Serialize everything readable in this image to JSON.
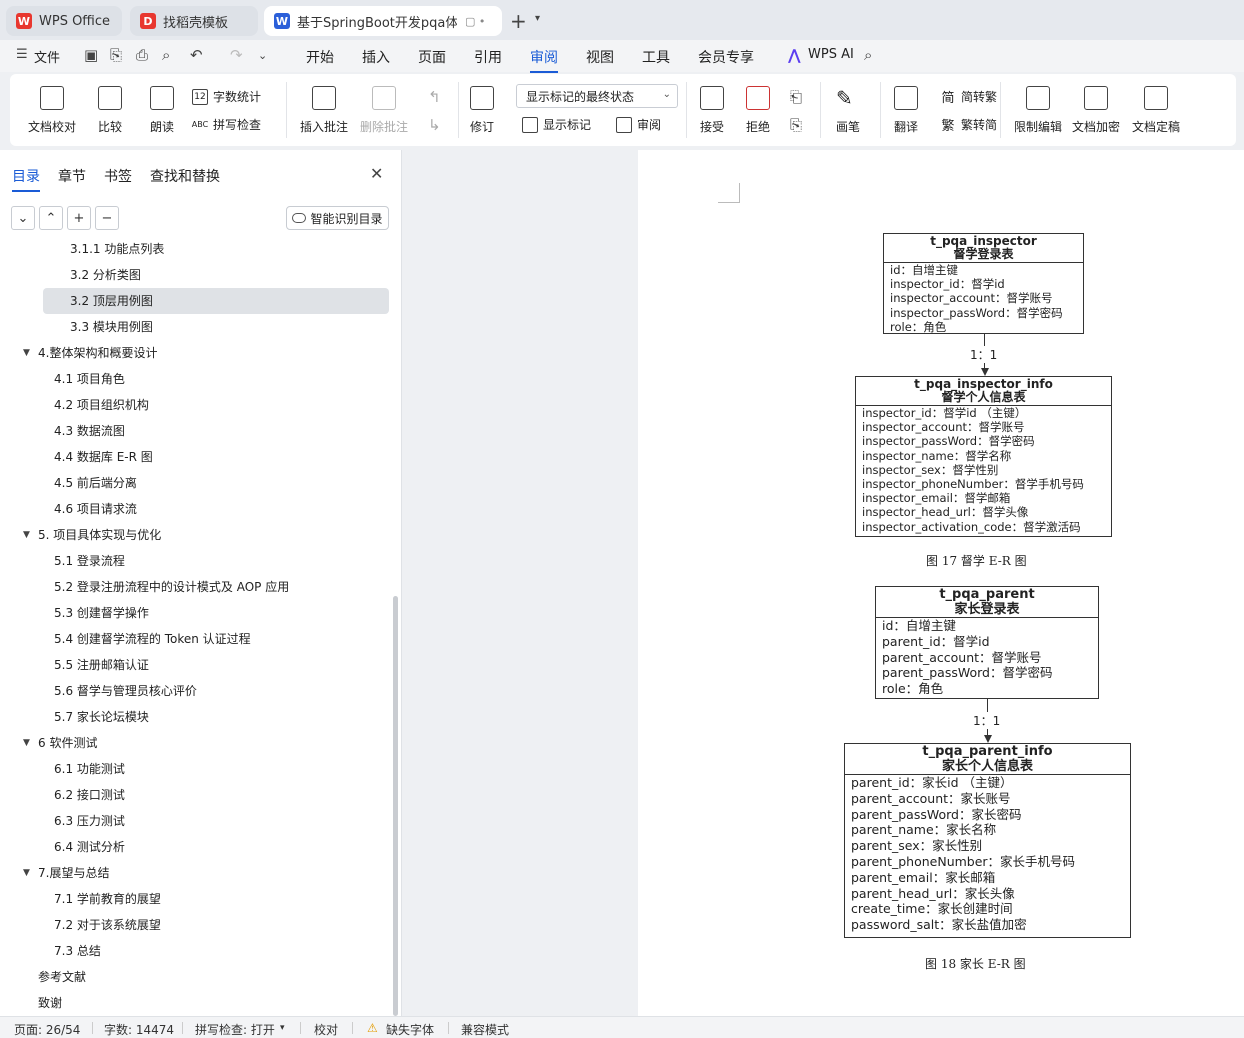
{
  "tabs": [
    {
      "label": "WPS Office",
      "logo": "W",
      "logo_color": "#e8372f"
    },
    {
      "label": "找稻壳模板",
      "logo": "D",
      "logo_color": "#e8372f"
    },
    {
      "label": "基于SpringBoot开发pqa体系",
      "logo": "W",
      "logo_color": "#2b5fd9",
      "extra": "▢ •"
    }
  ],
  "menu": {
    "file_label": "文件",
    "items": [
      "开始",
      "插入",
      "页面",
      "引用",
      "审阅",
      "视图",
      "工具",
      "会员专享"
    ],
    "active": "审阅",
    "wps_ai_label": "WPS AI"
  },
  "ribbon": {
    "doc_check": "文档校对",
    "compare": "比较",
    "read_aloud": "朗读",
    "word_count": "字数统计",
    "spell_check": "拼写检查",
    "insert_comment": "插入批注",
    "delete_comment": "删除批注",
    "revise": "修订",
    "markup_state": "显示标记的最终状态",
    "show_markup": "显示标记",
    "review": "审阅",
    "accept": "接受",
    "reject": "拒绝",
    "ink": "画笔",
    "translate": "翻译",
    "to_trad": "简转繁",
    "to_simp": "繁转简",
    "restrict_edit": "限制编辑",
    "encrypt": "文档加密",
    "finalize": "文档定稿"
  },
  "nav": {
    "tabs": [
      "目录",
      "章节",
      "书签",
      "查找和替换"
    ],
    "smart_toc_label": "智能识别目录",
    "toc": [
      {
        "label": "3.1.1 功能点列表",
        "level": 3
      },
      {
        "label": "3.2 分析类图",
        "level": 3
      },
      {
        "label": "3.2 顶层用例图",
        "level": 3,
        "selected": true
      },
      {
        "label": "3.3 模块用例图",
        "level": 3
      },
      {
        "label": "4.整体架构和概要设计",
        "level": 1,
        "expanded": true
      },
      {
        "label": "4.1 项目角色",
        "level": 2
      },
      {
        "label": "4.2 项目组织机构",
        "level": 2
      },
      {
        "label": "4.3 数据流图",
        "level": 2
      },
      {
        "label": "4.4 数据库 E-R 图",
        "level": 2
      },
      {
        "label": "4.5 前后端分离",
        "level": 2
      },
      {
        "label": "4.6 项目请求流",
        "level": 2
      },
      {
        "label": "5. 项目具体实现与优化",
        "level": 1,
        "expanded": true
      },
      {
        "label": "5.1 登录流程",
        "level": 2
      },
      {
        "label": "5.2 登录注册流程中的设计模式及 AOP 应用",
        "level": 2
      },
      {
        "label": "5.3 创建督学操作",
        "level": 2
      },
      {
        "label": "5.4 创建督学流程的 Token 认证过程",
        "level": 2
      },
      {
        "label": "5.5 注册邮箱认证",
        "level": 2
      },
      {
        "label": "5.6 督学与管理员核心评价",
        "level": 2
      },
      {
        "label": "5.7 家长论坛模块",
        "level": 2
      },
      {
        "label": "6 软件测试",
        "level": 1,
        "expanded": true
      },
      {
        "label": "6.1 功能测试",
        "level": 2
      },
      {
        "label": "6.2 接口测试",
        "level": 2
      },
      {
        "label": "6.3 压力测试",
        "level": 2
      },
      {
        "label": "6.4 测试分析",
        "level": 2
      },
      {
        "label": "7.展望与总结",
        "level": 1,
        "expanded": true
      },
      {
        "label": "7.1 学前教育的展望",
        "level": 2
      },
      {
        "label": "7.2 对于该系统展望",
        "level": 2
      },
      {
        "label": "7.3 总结",
        "level": 2
      },
      {
        "label": "参考文献",
        "level": 1
      },
      {
        "label": "致谢",
        "level": 1
      }
    ]
  },
  "doc": {
    "entities": [
      {
        "title": "t_pqa_inspector",
        "subtitle": "督学登录表",
        "fields": [
          "id：自增主键",
          "inspector_id：督学id",
          "inspector_account：督学账号",
          "inspector_passWord：督学密码",
          "role：角色"
        ]
      },
      {
        "title": "t_pqa_inspector_info",
        "subtitle": "督学个人信息表",
        "fields": [
          "inspector_id：督学id （主键）",
          "inspector_account：督学账号",
          "inspector_passWord：督学密码",
          "inspector_name：督学名称",
          "inspector_sex：督学性别",
          "inspector_phoneNumber：督学手机号码",
          "inspector_email：督学邮箱",
          "inspector_head_url：督学头像",
          "inspector_activation_code：督学激活码"
        ]
      },
      {
        "title": "t_pqa_parent",
        "subtitle": "家长登录表",
        "fields": [
          "id：自增主键",
          "parent_id：督学id",
          "parent_account：督学账号",
          "parent_passWord：督学密码",
          "role：角色"
        ]
      },
      {
        "title": "t_pqa_parent_info",
        "subtitle": "家长个人信息表",
        "fields": [
          "parent_id：家长id （主键）",
          "parent_account：家长账号",
          "parent_passWord：家长密码",
          "parent_name：家长名称",
          "parent_sex：家长性别",
          "parent_phoneNumber：家长手机号码",
          "parent_email：家长邮箱",
          "parent_head_url：家长头像",
          "create_time：家长创建时间",
          "password_salt：家长盐值加密"
        ]
      }
    ],
    "relations": [
      "1：1",
      "1：1"
    ],
    "captions": [
      "图 17 督学 E-R 图",
      "图 18 家长 E-R 图"
    ]
  },
  "status": {
    "page": "页面: 26/54",
    "words": "字数: 14474",
    "spell": "拼写检查: 打开",
    "proof": "校对",
    "missing_font": "缺失字体",
    "compat": "兼容模式"
  }
}
